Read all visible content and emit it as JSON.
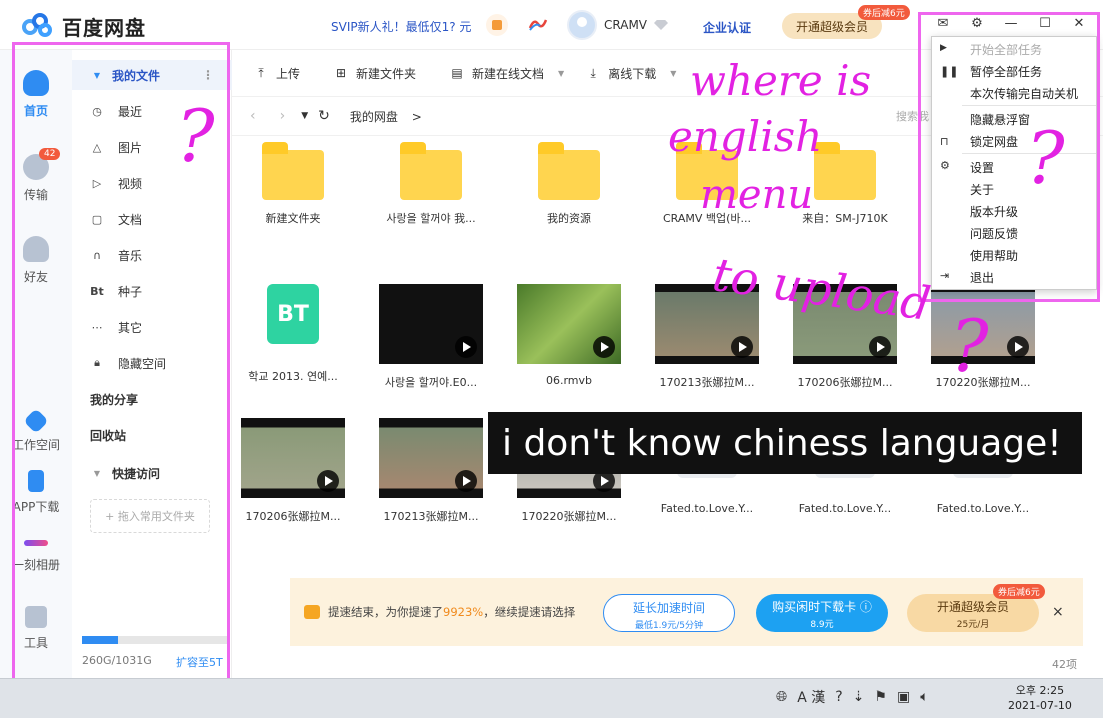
{
  "header": {
    "app_title": "百度网盘",
    "promo": "SVIP新人礼！最低仅1? 元",
    "username": "CRAMV",
    "enterprise": "企业认证",
    "vip_button": "开通超级会员",
    "vip_tag": "券后减6元"
  },
  "leftnav": {
    "items": [
      {
        "label": "首页"
      },
      {
        "label": "传输",
        "badge": "42"
      },
      {
        "label": "好友"
      },
      {
        "label": "工作空间"
      },
      {
        "label": "APP下载"
      },
      {
        "label": "一刻相册"
      },
      {
        "label": "工具"
      }
    ]
  },
  "sidebar": {
    "my_files": "我的文件",
    "items": [
      "最近",
      "图片",
      "视频",
      "文档",
      "音乐",
      "种子",
      "其它",
      "隐藏空间"
    ],
    "my_share": "我的分享",
    "recycle": "回收站",
    "quick_access": "快捷访问",
    "drop_hint": "+ 拖入常用文件夹",
    "storage": "260G/1031G",
    "storage_fraction": 0.25,
    "expand": "扩容至5T"
  },
  "toolbar": {
    "upload": "上传",
    "new_folder": "新建文件夹",
    "new_doc": "新建在线文档",
    "offline": "离线下载"
  },
  "path": {
    "current": "我的网盘",
    "sep": ">",
    "search_placeholder": "搜索我"
  },
  "files": [
    {
      "label": "新建文件夹",
      "type": "folder"
    },
    {
      "label": "사랑을 할꺼야 我...",
      "type": "folder"
    },
    {
      "label": "我的资源",
      "type": "folder"
    },
    {
      "label": "CRAMV 백업(바...",
      "type": "folder"
    },
    {
      "label": "来自：SM-J710K",
      "type": "folder"
    },
    {
      "label": "학교 2013. 연예...",
      "type": "bt"
    },
    {
      "label": "사랑을 할꺼야.E0...",
      "type": "video"
    },
    {
      "label": "06.rmvb",
      "type": "video"
    },
    {
      "label": "170213张娜拉M...",
      "type": "video"
    },
    {
      "label": "170206张娜拉M...",
      "type": "video"
    },
    {
      "label": "170220张娜拉M...",
      "type": "video"
    },
    {
      "label": "170206张娜拉M...",
      "type": "video"
    },
    {
      "label": "170213张娜拉M...",
      "type": "video"
    },
    {
      "label": "170220张娜拉M...",
      "type": "video"
    },
    {
      "label": "Fated.to.Love.Y...",
      "type": "ghost"
    },
    {
      "label": "Fated.to.Love.Y...",
      "type": "ghost"
    },
    {
      "label": "Fated.to.Love.Y...",
      "type": "ghost"
    }
  ],
  "banner": {
    "text_before": "提速结束，为你提速了",
    "percent": "9923%",
    "text_after": "，继续提速请选择",
    "btn1": "延长加速时间",
    "btn1_sub": "最低1.9元/5分钟",
    "btn2": "购买闲时下载卡 ⓘ",
    "btn2_sub": "8.9元",
    "btn3": "开通超级会员",
    "btn3_sub": "25元/月",
    "tag": "券后减6元",
    "close": "×"
  },
  "item_count": "42项",
  "caption": "i don't know chiness language!",
  "menu": {
    "items": [
      {
        "label": "开始全部任务",
        "disabled": true
      },
      {
        "label": "暂停全部任务"
      },
      {
        "label": "本次传输完自动关机"
      },
      {
        "label": "隐藏悬浮窗"
      },
      {
        "label": "锁定网盘"
      },
      {
        "label": "设置"
      },
      {
        "label": "关于"
      },
      {
        "label": "版本升级"
      },
      {
        "label": "问题反馈"
      },
      {
        "label": "使用帮助"
      },
      {
        "label": "退出"
      }
    ]
  },
  "annotations": {
    "line1": "where is",
    "line2": "english",
    "line3": "menu",
    "line4": "to upload",
    "q": "?"
  },
  "taskbar": {
    "ime": "A 漢",
    "time": "오후 2:25",
    "date": "2021-07-10"
  },
  "colors": {
    "accent": "#2f8cf2",
    "annotation": "#e222e2"
  }
}
